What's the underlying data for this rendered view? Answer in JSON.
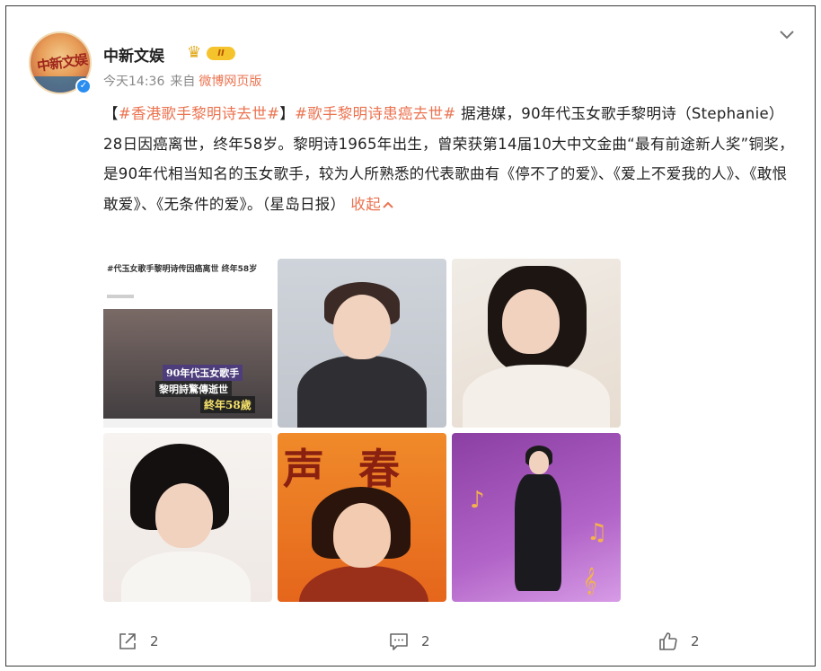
{
  "post": {
    "author": {
      "name": "中新文娱",
      "avatar_text": "中新文娱",
      "vip_level": "II",
      "verified_mark": "✓"
    },
    "meta": {
      "time": "今天14:36",
      "from_label": "来自",
      "source": "微博网页版"
    },
    "text": {
      "open_bracket": "【",
      "hashtag1": "#香港歌手黎明诗去世#",
      "close_bracket": "】",
      "hashtag2": "#歌手黎明诗患癌去世#",
      "body": " 据港媒，90年代玉女歌手黎明诗（Stephanie）28日因癌离世，终年58岁。黎明诗1965年出生，曾荣获第14届10大中文金曲“最有前途新人奖”铜奖，是90年代相当知名的玉女歌手，较为人所熟悉的代表歌曲有《停不了的爱》、《爱上不爱我的人》、《敢恨敢爱》、《无条件的爱》。（星岛日报）",
      "collapse": "收起"
    },
    "images": {
      "news_headline": "#代玉女歌手黎明诗传因癌离世 终年58岁",
      "caption1": "90年代玉女歌手",
      "caption2": "黎明詩驚傳逝世",
      "caption3": "終年58歲",
      "album_title": "声春"
    },
    "actions": {
      "share_count": "2",
      "comment_count": "2",
      "like_count": "2"
    }
  },
  "colors": {
    "accent": "#eb7350",
    "text": "#222222",
    "muted": "#8a8a8a"
  },
  "icons": [
    "chevron-down-icon",
    "crown-icon",
    "verified-icon",
    "share-icon",
    "comment-icon",
    "like-icon"
  ]
}
